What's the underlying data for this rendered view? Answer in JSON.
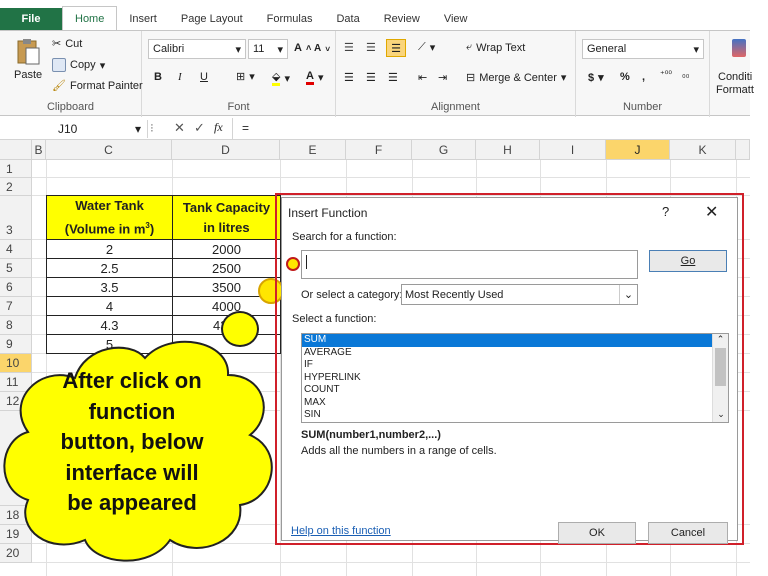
{
  "tabs": [
    "File",
    "Home",
    "Insert",
    "Page Layout",
    "Formulas",
    "Data",
    "Review",
    "View"
  ],
  "clipboard": {
    "paste": "Paste",
    "cut": "Cut",
    "copy": "Copy",
    "format_painter": "Format Painter",
    "label": "Clipboard"
  },
  "font": {
    "name": "Calibri",
    "size": "11",
    "bold": "B",
    "italic": "I",
    "underline": "U",
    "label": "Font"
  },
  "alignment": {
    "wrap": "Wrap Text",
    "merge": "Merge & Center",
    "label": "Alignment"
  },
  "number": {
    "format": "General",
    "currency": "$",
    "percent": "%",
    "comma": ",",
    "label": "Number"
  },
  "styles": {
    "cond": "Conditi",
    "format": "Formatt"
  },
  "formula_bar": {
    "name_box": "J10",
    "fx": "fx",
    "equals": "="
  },
  "columns": [
    "B",
    "C",
    "D",
    "E",
    "F",
    "G",
    "H",
    "I",
    "J",
    "K"
  ],
  "rows": [
    "1",
    "2",
    "3",
    "4",
    "5",
    "6",
    "7",
    "8",
    "9",
    "10",
    "11",
    "12",
    "18",
    "19",
    "20"
  ],
  "table": {
    "header_c_line1": "Water Tank",
    "header_c_line2": "(Volume in m",
    "header_c_sup": "3",
    "header_c_end": ")",
    "header_d_line1": "Tank Capacity",
    "header_d_line2": "in litres",
    "volumes": [
      "2",
      "2.5",
      "3.5",
      "4",
      "4.3",
      "5"
    ],
    "capacities": [
      "2000",
      "2500",
      "3500",
      "4000",
      "43"
    ]
  },
  "callout": {
    "text": [
      "After click on",
      "function",
      "button, below",
      "interface will",
      "be appeared"
    ]
  },
  "dialog": {
    "title": "Insert Function",
    "help_char": "?",
    "close_char": "✕",
    "search_label": "Search for a function:",
    "search_value": "",
    "go": "Go",
    "category_label": "Or select a category:",
    "category_value": "Most Recently Used",
    "select_label": "Select a function:",
    "functions": [
      "SUM",
      "AVERAGE",
      "IF",
      "HYPERLINK",
      "COUNT",
      "MAX",
      "SIN"
    ],
    "signature": "SUM(number1,number2,...)",
    "description": "Adds all the numbers in a range of cells.",
    "help_link": "Help on this function",
    "ok": "OK",
    "cancel": "Cancel"
  },
  "colors": {
    "excel_green": "#217346",
    "highlight": "#ffff00",
    "select_blue": "#0a78d7",
    "callout_yellow": "#ffff00",
    "red_frame": "#d0202a"
  }
}
